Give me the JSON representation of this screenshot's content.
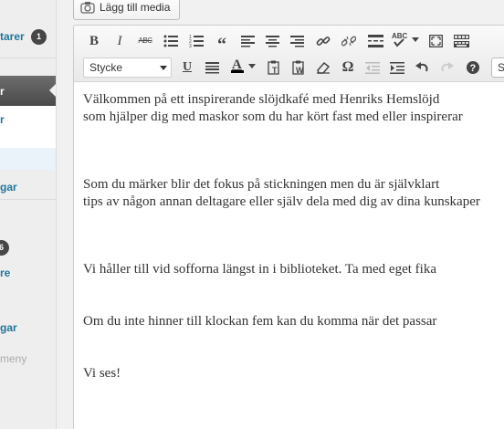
{
  "sidebar": {
    "comments_label": "tarer",
    "comments_count": "1",
    "current_label": "r",
    "submenu_first": "r",
    "item_a": "gar",
    "item_b": "",
    "badge_count": "6",
    "item_c": "re",
    "item_d": "",
    "item_e": "gar",
    "collapse_label": "meny"
  },
  "media_button": {
    "label": "Lägg till media",
    "icon": "media-camera-icon"
  },
  "toolbar": {
    "row1": [
      "bold",
      "italic",
      "strikethrough",
      "bullet-list",
      "numbered-list",
      "blockquote",
      "align-left",
      "align-center",
      "align-right",
      "insert-link",
      "remove-link",
      "insert-more",
      "spellcheck",
      "fullscreen",
      "kitchen-sink"
    ],
    "bold_label": "B",
    "italic_label": "I",
    "strike_label": "ABC",
    "quote_label": "“",
    "underline_label": "U",
    "color_label": "A",
    "omega_label": "Ω",
    "format_select": "Stycke",
    "cut_label": "S"
  },
  "content": {
    "paragraphs": [
      [
        "Välkommen på ett inspirerande slöjdkafé med Henriks Hemslöjd",
        "som hjälper dig med maskor som du har kört fast med eller inspirerar"
      ],
      [
        "Som du märker blir det fokus på stickningen men du är självklart",
        "tips av någon annan deltagare eller själv dela med dig av dina kunskaper"
      ],
      [
        "Vi håller till vid sofforna längst in i biblioteket. Ta med eget fika"
      ],
      [
        "Om du inte hinner till klockan fem kan du komma när det passar"
      ],
      [
        "Vi ses!"
      ]
    ]
  },
  "colors": {
    "link": "#21759b",
    "menu_current": "#5a5a5a",
    "toolbar_bg": "#f0f0f0",
    "text": "#333333"
  }
}
